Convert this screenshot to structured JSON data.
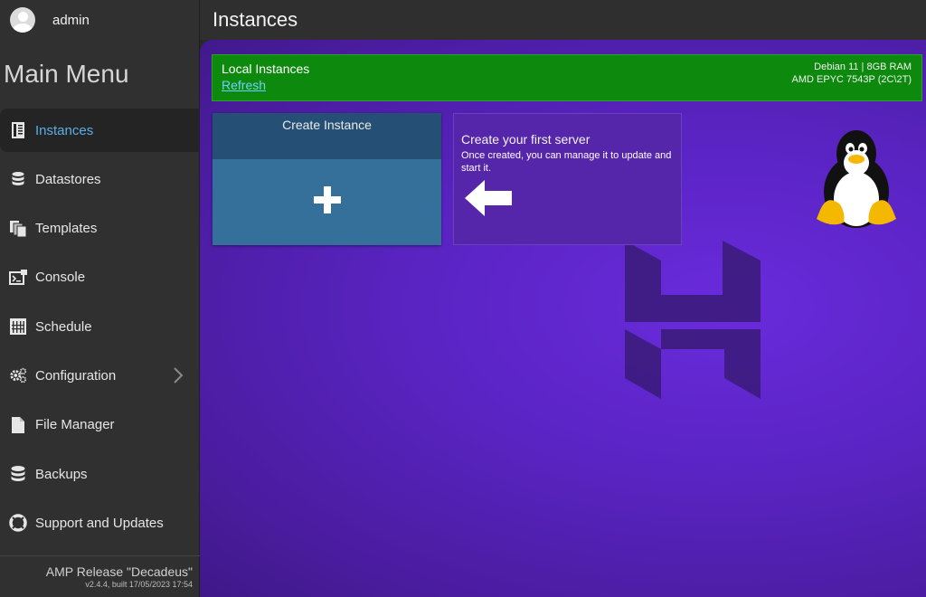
{
  "user": {
    "name": "admin"
  },
  "sidebar": {
    "title": "Main Menu",
    "items": [
      {
        "label": "Instances",
        "icon": "instances-icon",
        "active": true
      },
      {
        "label": "Datastores",
        "icon": "database-icon"
      },
      {
        "label": "Templates",
        "icon": "templates-icon"
      },
      {
        "label": "Console",
        "icon": "console-icon"
      },
      {
        "label": "Schedule",
        "icon": "schedule-icon"
      },
      {
        "label": "Configuration",
        "icon": "gears-icon",
        "submenu": true
      },
      {
        "label": "File Manager",
        "icon": "file-icon"
      },
      {
        "label": "Backups",
        "icon": "backups-icon"
      },
      {
        "label": "Support and Updates",
        "icon": "lifebuoy-icon"
      }
    ],
    "footer": {
      "release": "AMP Release \"Decadeus\"",
      "build": "v2.4.4, built 17/05/2023 17:54"
    }
  },
  "header": {
    "title": "Instances"
  },
  "status": {
    "title": "Local Instances",
    "refresh_label": "Refresh",
    "os": "Debian  11 | 8GB RAM",
    "cpu": "AMD EPYC 7543P (2C\\2T)"
  },
  "create_card": {
    "label": "Create Instance",
    "icon": "plus-icon"
  },
  "hint_card": {
    "heading": "Create your first server",
    "body": "Once created, you can manage it to update and start it.",
    "icon": "arrow-left-icon"
  },
  "colors": {
    "accent": "#5ab0e8",
    "status_green": "#0d8a0d",
    "main_purple": "#5a24c4",
    "create_blue": "#34709a"
  }
}
